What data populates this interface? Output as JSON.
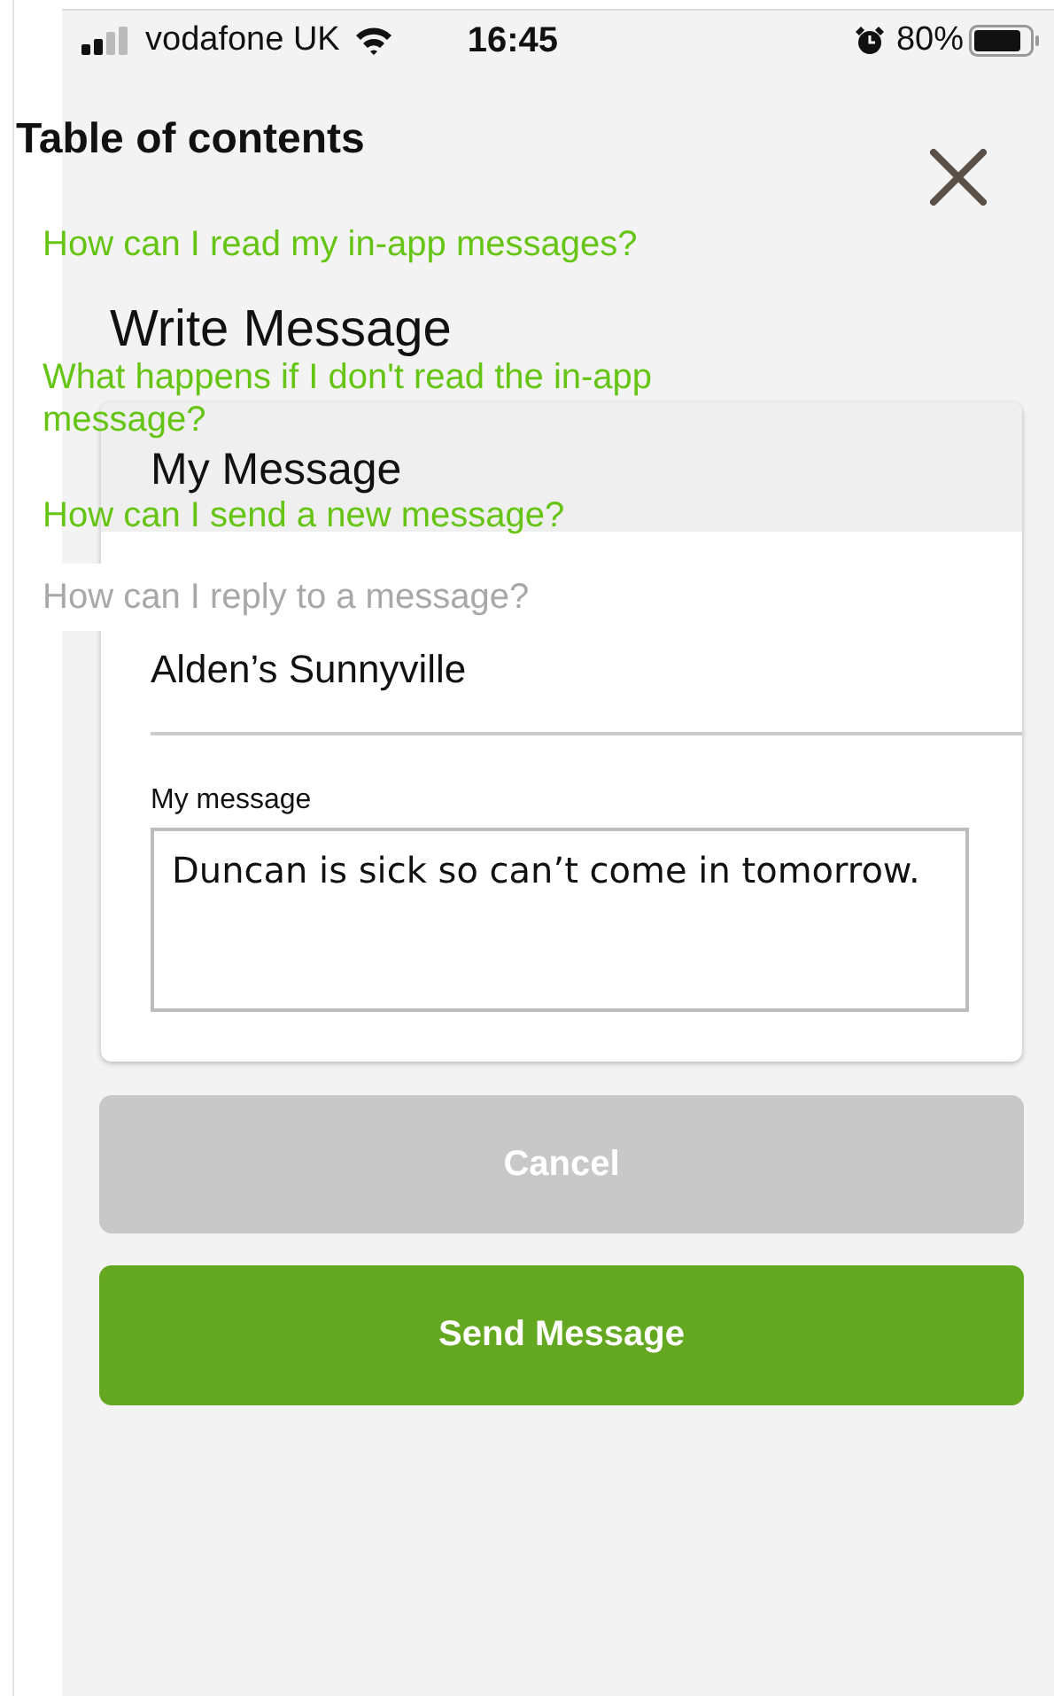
{
  "status_bar": {
    "carrier": "vodafone UK",
    "time": "16:45",
    "battery": "80%"
  },
  "screen": {
    "title": "Write Message",
    "card_title": "My Message",
    "location": "Alden’s Sunnyville",
    "message_label": "My message",
    "message_value": "Duncan is sick so can’t come in tomorrow.",
    "buttons": [
      {
        "label": "Cancel",
        "kind": "secondary"
      },
      {
        "label": "Send Message",
        "kind": "primary"
      }
    ]
  },
  "toc": {
    "title": "Table of contents",
    "items": [
      {
        "label": "How can I read my in-app messages?",
        "selected": false
      },
      {
        "label": "What happens if I don't read the in-app message?",
        "selected": false
      },
      {
        "label": "How can I send a new message?",
        "selected": false
      },
      {
        "label": "How can I reply to a message?",
        "selected": true
      }
    ]
  }
}
